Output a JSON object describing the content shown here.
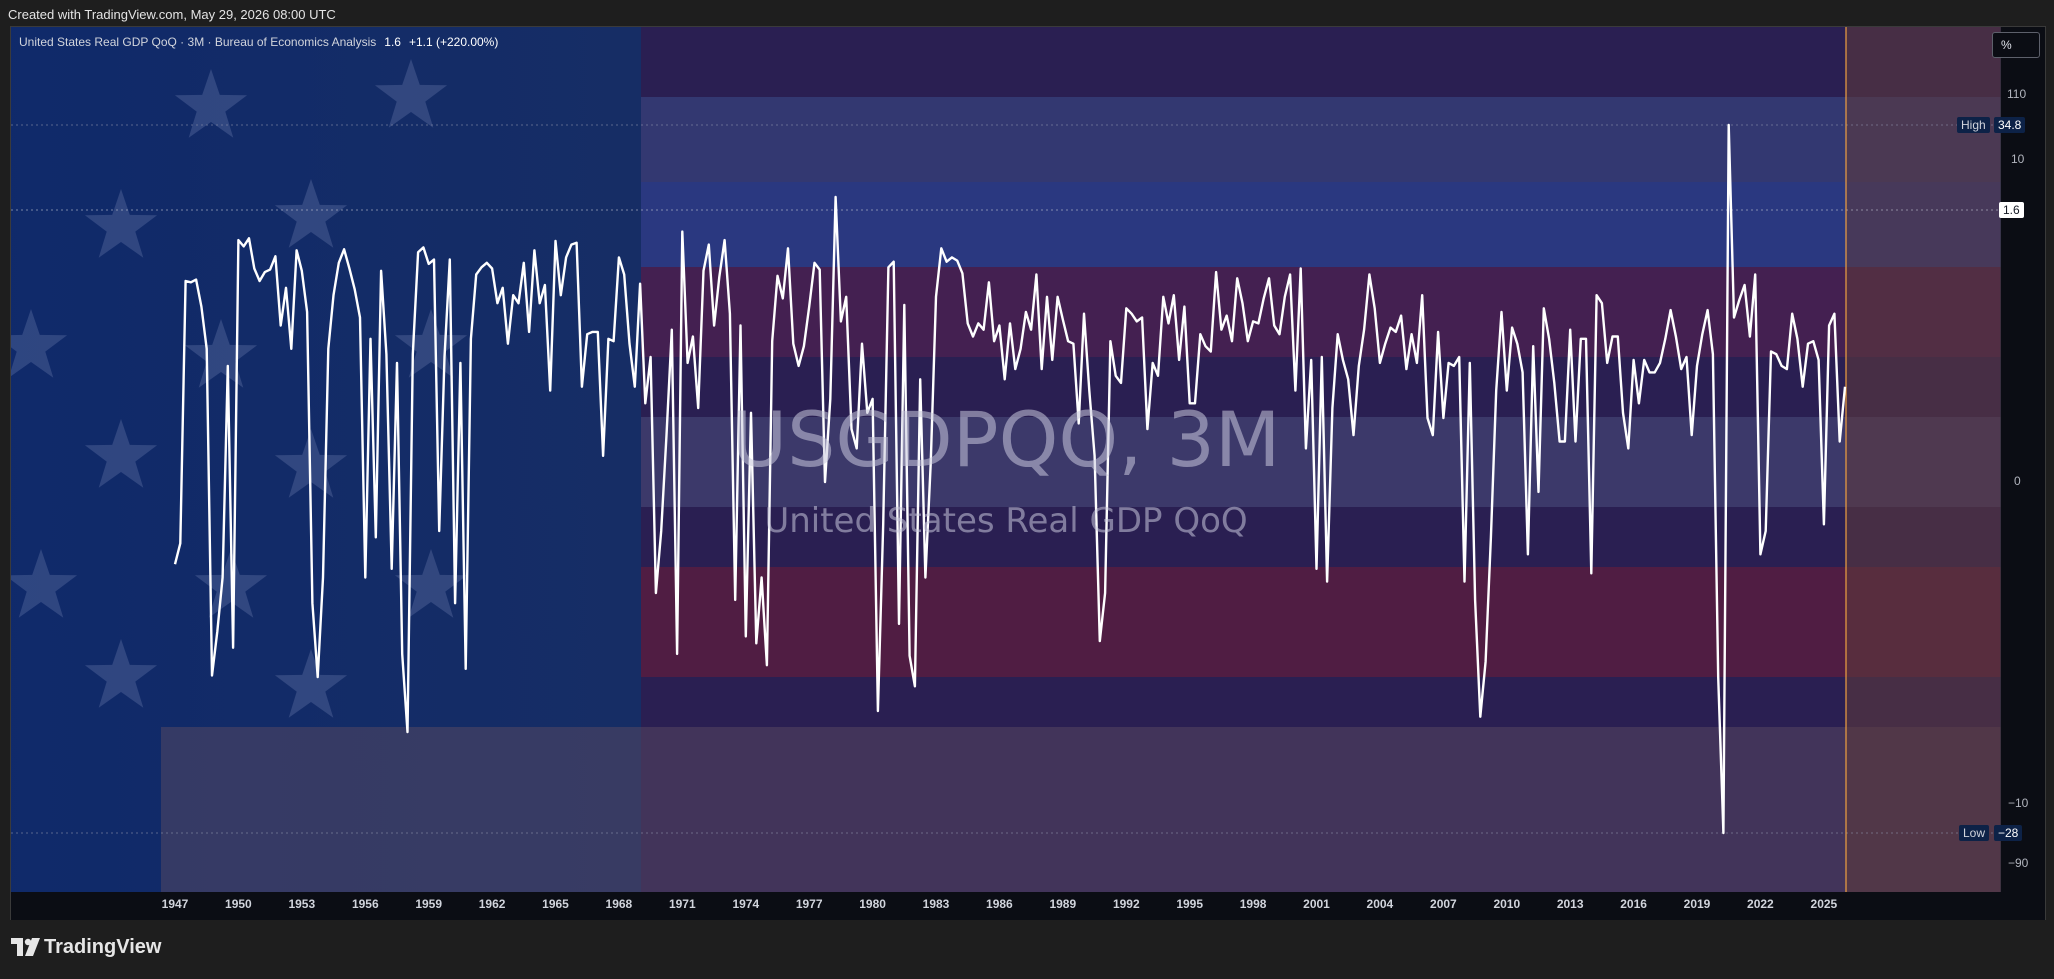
{
  "topbar": {
    "created_text": "Created with TradingView.com, May 29, 2026 08:00 UTC"
  },
  "legend": {
    "title": "United States Real GDP QoQ · 3M · Bureau of Economics Analysis",
    "last_value": "1.6",
    "change": "+1.1 (+220.00%)"
  },
  "scale_button": "%",
  "watermark": {
    "symbol": "USGDPQQ, 3M",
    "description": "United States Real GDP QoQ"
  },
  "price_axis": {
    "ticks": [
      "110",
      "10",
      "0",
      "−10",
      "−90"
    ],
    "high_label": "High",
    "high_value": "34.8",
    "low_label": "Low",
    "low_value": "−28",
    "last_value": "1.6"
  },
  "footer": {
    "brand": "TradingView"
  },
  "colors": {
    "line": "#ffffff",
    "background": "#131722",
    "accent_projection": "#f0a040",
    "tag_blue": "#0d2247"
  },
  "chart_data": {
    "type": "line",
    "title": "United States Real GDP QoQ",
    "series_name": "USGDPQQ",
    "unit": "%",
    "scale": "log-symmetric (percent)",
    "x_ticks": [
      "1947",
      "1950",
      "1953",
      "1956",
      "1959",
      "1962",
      "1965",
      "1968",
      "1971",
      "1974",
      "1977",
      "1980",
      "1983",
      "1986",
      "1989",
      "1992",
      "1995",
      "1998",
      "2001",
      "2004",
      "2007",
      "2010",
      "2013",
      "2016",
      "2019",
      "2022",
      "2025"
    ],
    "x_range": [
      1940.4,
      2033.5
    ],
    "high": 34.8,
    "low": -28,
    "last": 1.6,
    "series": [
      {
        "x": 1947.0,
        "y": -1.2
      },
      {
        "x": 1947.25,
        "y": -0.8
      },
      {
        "x": 1947.5,
        "y": 6.5
      },
      {
        "x": 1947.75,
        "y": 6.4
      },
      {
        "x": 1948.0,
        "y": 6.6
      },
      {
        "x": 1948.25,
        "y": 4.8
      },
      {
        "x": 1948.5,
        "y": 2.8
      },
      {
        "x": 1948.75,
        "y": -5.4
      },
      {
        "x": 1949.0,
        "y": -3.2
      },
      {
        "x": 1949.25,
        "y": -1.5
      },
      {
        "x": 1949.5,
        "y": 2.2
      },
      {
        "x": 1949.75,
        "y": -3.9
      },
      {
        "x": 1950.0,
        "y": 10.3
      },
      {
        "x": 1950.25,
        "y": 9.6
      },
      {
        "x": 1950.5,
        "y": 10.5
      },
      {
        "x": 1950.75,
        "y": 7.5
      },
      {
        "x": 1951.0,
        "y": 6.5
      },
      {
        "x": 1951.25,
        "y": 7.2
      },
      {
        "x": 1951.5,
        "y": 7.4
      },
      {
        "x": 1951.75,
        "y": 8.6
      },
      {
        "x": 1952.0,
        "y": 3.8
      },
      {
        "x": 1952.25,
        "y": 6.0
      },
      {
        "x": 1952.5,
        "y": 2.8
      },
      {
        "x": 1952.75,
        "y": 9.2
      },
      {
        "x": 1953.0,
        "y": 7.3
      },
      {
        "x": 1953.25,
        "y": 4.5
      },
      {
        "x": 1953.5,
        "y": -2.2
      },
      {
        "x": 1953.75,
        "y": -5.5
      },
      {
        "x": 1954.0,
        "y": -1.5
      },
      {
        "x": 1954.25,
        "y": 2.8
      },
      {
        "x": 1954.5,
        "y": 5.5
      },
      {
        "x": 1954.75,
        "y": 8.0
      },
      {
        "x": 1955.0,
        "y": 9.3
      },
      {
        "x": 1955.25,
        "y": 7.5
      },
      {
        "x": 1955.5,
        "y": 5.9
      },
      {
        "x": 1955.75,
        "y": 4.2
      },
      {
        "x": 1956.0,
        "y": -1.5
      },
      {
        "x": 1956.25,
        "y": 3.2
      },
      {
        "x": 1956.5,
        "y": -0.7
      },
      {
        "x": 1956.75,
        "y": 7.3
      },
      {
        "x": 1957.0,
        "y": 2.6
      },
      {
        "x": 1957.25,
        "y": -1.3
      },
      {
        "x": 1957.5,
        "y": 2.3
      },
      {
        "x": 1957.75,
        "y": -4.2
      },
      {
        "x": 1958.0,
        "y": -10.0
      },
      {
        "x": 1958.25,
        "y": 2.6
      },
      {
        "x": 1958.5,
        "y": 9.0
      },
      {
        "x": 1958.75,
        "y": 9.5
      },
      {
        "x": 1959.0,
        "y": 7.9
      },
      {
        "x": 1959.25,
        "y": 8.3
      },
      {
        "x": 1959.5,
        "y": -0.6
      },
      {
        "x": 1959.75,
        "y": 2.5
      },
      {
        "x": 1960.0,
        "y": 8.3
      },
      {
        "x": 1960.25,
        "y": -2.2
      },
      {
        "x": 1960.5,
        "y": 2.3
      },
      {
        "x": 1960.75,
        "y": -5.0
      },
      {
        "x": 1961.0,
        "y": 3.2
      },
      {
        "x": 1961.25,
        "y": 7.0
      },
      {
        "x": 1961.5,
        "y": 7.6
      },
      {
        "x": 1961.75,
        "y": 8.0
      },
      {
        "x": 1962.0,
        "y": 7.5
      },
      {
        "x": 1962.25,
        "y": 5.0
      },
      {
        "x": 1962.5,
        "y": 6.0
      },
      {
        "x": 1962.75,
        "y": 3.0
      },
      {
        "x": 1963.0,
        "y": 5.5
      },
      {
        "x": 1963.25,
        "y": 5.0
      },
      {
        "x": 1963.5,
        "y": 8.0
      },
      {
        "x": 1963.75,
        "y": 3.5
      },
      {
        "x": 1964.0,
        "y": 9.2
      },
      {
        "x": 1964.25,
        "y": 5.0
      },
      {
        "x": 1964.5,
        "y": 6.2
      },
      {
        "x": 1964.75,
        "y": 1.5
      },
      {
        "x": 1965.0,
        "y": 10.2
      },
      {
        "x": 1965.25,
        "y": 5.5
      },
      {
        "x": 1965.5,
        "y": 8.5
      },
      {
        "x": 1965.75,
        "y": 9.8
      },
      {
        "x": 1966.0,
        "y": 10.0
      },
      {
        "x": 1966.25,
        "y": 1.6
      },
      {
        "x": 1966.5,
        "y": 3.4
      },
      {
        "x": 1966.75,
        "y": 3.5
      },
      {
        "x": 1967.0,
        "y": 3.5
      },
      {
        "x": 1967.25,
        "y": 0.3
      },
      {
        "x": 1967.5,
        "y": 3.2
      },
      {
        "x": 1967.75,
        "y": 3.1
      },
      {
        "x": 1968.0,
        "y": 8.5
      },
      {
        "x": 1968.25,
        "y": 7.0
      },
      {
        "x": 1968.5,
        "y": 3.0
      },
      {
        "x": 1968.75,
        "y": 1.6
      },
      {
        "x": 1969.0,
        "y": 6.3
      },
      {
        "x": 1969.25,
        "y": 1.2
      },
      {
        "x": 1969.5,
        "y": 2.5
      },
      {
        "x": 1969.75,
        "y": -1.9
      },
      {
        "x": 1970.0,
        "y": -0.6
      },
      {
        "x": 1970.25,
        "y": 0.6
      },
      {
        "x": 1970.5,
        "y": 3.6
      },
      {
        "x": 1970.75,
        "y": -4.2
      },
      {
        "x": 1971.0,
        "y": 11.3
      },
      {
        "x": 1971.25,
        "y": 2.3
      },
      {
        "x": 1971.5,
        "y": 3.3
      },
      {
        "x": 1971.75,
        "y": 1.1
      },
      {
        "x": 1972.0,
        "y": 7.3
      },
      {
        "x": 1972.25,
        "y": 9.8
      },
      {
        "x": 1972.5,
        "y": 3.8
      },
      {
        "x": 1972.75,
        "y": 6.8
      },
      {
        "x": 1973.0,
        "y": 10.3
      },
      {
        "x": 1973.25,
        "y": 4.4
      },
      {
        "x": 1973.5,
        "y": -2.1
      },
      {
        "x": 1973.75,
        "y": 3.8
      },
      {
        "x": 1974.0,
        "y": -3.4
      },
      {
        "x": 1974.25,
        "y": 1.0
      },
      {
        "x": 1974.5,
        "y": -3.7
      },
      {
        "x": 1974.75,
        "y": -1.5
      },
      {
        "x": 1975.0,
        "y": -4.8
      },
      {
        "x": 1975.25,
        "y": 3.1
      },
      {
        "x": 1975.5,
        "y": 6.9
      },
      {
        "x": 1975.75,
        "y": 5.3
      },
      {
        "x": 1976.0,
        "y": 9.4
      },
      {
        "x": 1976.25,
        "y": 3.0
      },
      {
        "x": 1976.5,
        "y": 2.2
      },
      {
        "x": 1976.75,
        "y": 2.9
      },
      {
        "x": 1977.0,
        "y": 4.8
      },
      {
        "x": 1977.25,
        "y": 8.0
      },
      {
        "x": 1977.5,
        "y": 7.4
      },
      {
        "x": 1977.75,
        "y": 0.0
      },
      {
        "x": 1978.0,
        "y": 1.3
      },
      {
        "x": 1978.25,
        "y": 16.4
      },
      {
        "x": 1978.5,
        "y": 4.0
      },
      {
        "x": 1978.75,
        "y": 5.4
      },
      {
        "x": 1979.0,
        "y": 0.7
      },
      {
        "x": 1979.25,
        "y": 0.4
      },
      {
        "x": 1979.5,
        "y": 3.0
      },
      {
        "x": 1979.75,
        "y": 1.0
      },
      {
        "x": 1980.0,
        "y": 1.3
      },
      {
        "x": 1980.25,
        "y": -8.0
      },
      {
        "x": 1980.5,
        "y": -0.5
      },
      {
        "x": 1980.75,
        "y": 7.6
      },
      {
        "x": 1981.0,
        "y": 8.1
      },
      {
        "x": 1981.25,
        "y": -2.9
      },
      {
        "x": 1981.5,
        "y": 4.9
      },
      {
        "x": 1981.75,
        "y": -4.3
      },
      {
        "x": 1982.0,
        "y": -6.1
      },
      {
        "x": 1982.25,
        "y": 1.8
      },
      {
        "x": 1982.5,
        "y": -1.5
      },
      {
        "x": 1982.75,
        "y": 0.2
      },
      {
        "x": 1983.0,
        "y": 5.4
      },
      {
        "x": 1983.25,
        "y": 9.4
      },
      {
        "x": 1983.5,
        "y": 8.1
      },
      {
        "x": 1983.75,
        "y": 8.5
      },
      {
        "x": 1984.0,
        "y": 8.2
      },
      {
        "x": 1984.25,
        "y": 7.1
      },
      {
        "x": 1984.5,
        "y": 3.9
      },
      {
        "x": 1984.75,
        "y": 3.3
      },
      {
        "x": 1985.0,
        "y": 3.9
      },
      {
        "x": 1985.25,
        "y": 3.6
      },
      {
        "x": 1985.5,
        "y": 6.4
      },
      {
        "x": 1985.75,
        "y": 3.1
      },
      {
        "x": 1986.0,
        "y": 3.8
      },
      {
        "x": 1986.25,
        "y": 1.8
      },
      {
        "x": 1986.5,
        "y": 3.9
      },
      {
        "x": 1986.75,
        "y": 2.1
      },
      {
        "x": 1987.0,
        "y": 2.8
      },
      {
        "x": 1987.25,
        "y": 4.5
      },
      {
        "x": 1987.5,
        "y": 3.6
      },
      {
        "x": 1987.75,
        "y": 7.0
      },
      {
        "x": 1988.0,
        "y": 2.1
      },
      {
        "x": 1988.25,
        "y": 5.4
      },
      {
        "x": 1988.5,
        "y": 2.4
      },
      {
        "x": 1988.75,
        "y": 5.4
      },
      {
        "x": 1989.0,
        "y": 4.1
      },
      {
        "x": 1989.25,
        "y": 3.1
      },
      {
        "x": 1989.5,
        "y": 3.0
      },
      {
        "x": 1989.75,
        "y": 0.8
      },
      {
        "x": 1990.0,
        "y": 4.4
      },
      {
        "x": 1990.25,
        "y": 1.5
      },
      {
        "x": 1990.5,
        "y": 0.3
      },
      {
        "x": 1990.75,
        "y": -3.6
      },
      {
        "x": 1991.0,
        "y": -1.9
      },
      {
        "x": 1991.25,
        "y": 3.1
      },
      {
        "x": 1991.5,
        "y": 1.9
      },
      {
        "x": 1991.75,
        "y": 1.7
      },
      {
        "x": 1992.0,
        "y": 4.7
      },
      {
        "x": 1992.25,
        "y": 4.4
      },
      {
        "x": 1992.5,
        "y": 4.0
      },
      {
        "x": 1992.75,
        "y": 4.2
      },
      {
        "x": 1993.0,
        "y": 0.7
      },
      {
        "x": 1993.25,
        "y": 2.3
      },
      {
        "x": 1993.5,
        "y": 1.9
      },
      {
        "x": 1993.75,
        "y": 5.4
      },
      {
        "x": 1994.0,
        "y": 3.9
      },
      {
        "x": 1994.25,
        "y": 5.5
      },
      {
        "x": 1994.5,
        "y": 2.4
      },
      {
        "x": 1994.75,
        "y": 4.8
      },
      {
        "x": 1995.0,
        "y": 1.2
      },
      {
        "x": 1995.25,
        "y": 1.2
      },
      {
        "x": 1995.5,
        "y": 3.4
      },
      {
        "x": 1995.75,
        "y": 2.9
      },
      {
        "x": 1996.0,
        "y": 2.7
      },
      {
        "x": 1996.25,
        "y": 7.2
      },
      {
        "x": 1996.5,
        "y": 3.6
      },
      {
        "x": 1996.75,
        "y": 4.3
      },
      {
        "x": 1997.0,
        "y": 3.1
      },
      {
        "x": 1997.25,
        "y": 6.7
      },
      {
        "x": 1997.5,
        "y": 5.0
      },
      {
        "x": 1997.75,
        "y": 3.1
      },
      {
        "x": 1998.0,
        "y": 4.0
      },
      {
        "x": 1998.25,
        "y": 3.9
      },
      {
        "x": 1998.5,
        "y": 5.3
      },
      {
        "x": 1998.75,
        "y": 6.7
      },
      {
        "x": 1999.0,
        "y": 3.8
      },
      {
        "x": 1999.25,
        "y": 3.4
      },
      {
        "x": 1999.5,
        "y": 5.4
      },
      {
        "x": 1999.75,
        "y": 7.0
      },
      {
        "x": 2000.0,
        "y": 1.5
      },
      {
        "x": 2000.25,
        "y": 7.5
      },
      {
        "x": 2000.5,
        "y": 0.4
      },
      {
        "x": 2000.75,
        "y": 2.4
      },
      {
        "x": 2001.0,
        "y": -1.3
      },
      {
        "x": 2001.25,
        "y": 2.5
      },
      {
        "x": 2001.5,
        "y": -1.6
      },
      {
        "x": 2001.75,
        "y": 1.1
      },
      {
        "x": 2002.0,
        "y": 3.4
      },
      {
        "x": 2002.25,
        "y": 2.4
      },
      {
        "x": 2002.5,
        "y": 1.8
      },
      {
        "x": 2002.75,
        "y": 0.6
      },
      {
        "x": 2003.0,
        "y": 2.2
      },
      {
        "x": 2003.25,
        "y": 3.6
      },
      {
        "x": 2003.5,
        "y": 7.0
      },
      {
        "x": 2003.75,
        "y": 4.7
      },
      {
        "x": 2004.0,
        "y": 2.3
      },
      {
        "x": 2004.25,
        "y": 3.0
      },
      {
        "x": 2004.5,
        "y": 3.7
      },
      {
        "x": 2004.75,
        "y": 3.5
      },
      {
        "x": 2005.0,
        "y": 4.3
      },
      {
        "x": 2005.25,
        "y": 2.1
      },
      {
        "x": 2005.5,
        "y": 3.4
      },
      {
        "x": 2005.75,
        "y": 2.3
      },
      {
        "x": 2006.0,
        "y": 5.5
      },
      {
        "x": 2006.25,
        "y": 0.9
      },
      {
        "x": 2006.5,
        "y": 0.6
      },
      {
        "x": 2006.75,
        "y": 3.5
      },
      {
        "x": 2007.0,
        "y": 0.9
      },
      {
        "x": 2007.25,
        "y": 2.3
      },
      {
        "x": 2007.5,
        "y": 2.2
      },
      {
        "x": 2007.75,
        "y": 2.5
      },
      {
        "x": 2008.0,
        "y": -1.6
      },
      {
        "x": 2008.25,
        "y": 2.3
      },
      {
        "x": 2008.5,
        "y": -2.1
      },
      {
        "x": 2008.75,
        "y": -8.5
      },
      {
        "x": 2009.0,
        "y": -4.6
      },
      {
        "x": 2009.25,
        "y": -0.7
      },
      {
        "x": 2009.5,
        "y": 1.5
      },
      {
        "x": 2009.75,
        "y": 4.5
      },
      {
        "x": 2010.0,
        "y": 1.5
      },
      {
        "x": 2010.25,
        "y": 3.7
      },
      {
        "x": 2010.5,
        "y": 3.0
      },
      {
        "x": 2010.75,
        "y": 2.0
      },
      {
        "x": 2011.0,
        "y": -1.0
      },
      {
        "x": 2011.25,
        "y": 2.9
      },
      {
        "x": 2011.5,
        "y": -0.1
      },
      {
        "x": 2011.75,
        "y": 4.7
      },
      {
        "x": 2012.0,
        "y": 3.2
      },
      {
        "x": 2012.25,
        "y": 1.7
      },
      {
        "x": 2012.5,
        "y": 0.5
      },
      {
        "x": 2012.75,
        "y": 0.5
      },
      {
        "x": 2013.0,
        "y": 3.6
      },
      {
        "x": 2013.25,
        "y": 0.5
      },
      {
        "x": 2013.5,
        "y": 3.2
      },
      {
        "x": 2013.75,
        "y": 3.2
      },
      {
        "x": 2014.0,
        "y": -1.4
      },
      {
        "x": 2014.25,
        "y": 5.5
      },
      {
        "x": 2014.5,
        "y": 5.0
      },
      {
        "x": 2014.75,
        "y": 2.3
      },
      {
        "x": 2015.0,
        "y": 3.3
      },
      {
        "x": 2015.25,
        "y": 3.3
      },
      {
        "x": 2015.5,
        "y": 1.0
      },
      {
        "x": 2015.75,
        "y": 0.4
      },
      {
        "x": 2016.0,
        "y": 2.4
      },
      {
        "x": 2016.25,
        "y": 1.2
      },
      {
        "x": 2016.5,
        "y": 2.4
      },
      {
        "x": 2016.75,
        "y": 2.0
      },
      {
        "x": 2017.0,
        "y": 2.0
      },
      {
        "x": 2017.25,
        "y": 2.3
      },
      {
        "x": 2017.5,
        "y": 3.2
      },
      {
        "x": 2017.75,
        "y": 4.6
      },
      {
        "x": 2018.0,
        "y": 3.3
      },
      {
        "x": 2018.25,
        "y": 2.1
      },
      {
        "x": 2018.5,
        "y": 2.5
      },
      {
        "x": 2018.75,
        "y": 0.6
      },
      {
        "x": 2019.0,
        "y": 2.2
      },
      {
        "x": 2019.25,
        "y": 3.4
      },
      {
        "x": 2019.5,
        "y": 4.6
      },
      {
        "x": 2019.75,
        "y": 2.6
      },
      {
        "x": 2020.0,
        "y": -5.5
      },
      {
        "x": 2020.25,
        "y": -28.0
      },
      {
        "x": 2020.5,
        "y": 34.8
      },
      {
        "x": 2020.75,
        "y": 4.2
      },
      {
        "x": 2021.0,
        "y": 5.2
      },
      {
        "x": 2021.25,
        "y": 6.2
      },
      {
        "x": 2021.5,
        "y": 3.3
      },
      {
        "x": 2021.75,
        "y": 7.0
      },
      {
        "x": 2022.0,
        "y": -1.0
      },
      {
        "x": 2022.25,
        "y": -0.6
      },
      {
        "x": 2022.5,
        "y": 2.7
      },
      {
        "x": 2022.75,
        "y": 2.6
      },
      {
        "x": 2023.0,
        "y": 2.2
      },
      {
        "x": 2023.25,
        "y": 2.1
      },
      {
        "x": 2023.5,
        "y": 4.4
      },
      {
        "x": 2023.75,
        "y": 3.2
      },
      {
        "x": 2024.0,
        "y": 1.6
      },
      {
        "x": 2024.25,
        "y": 3.0
      },
      {
        "x": 2024.5,
        "y": 3.1
      },
      {
        "x": 2024.75,
        "y": 2.4
      },
      {
        "x": 2025.0,
        "y": -0.5
      },
      {
        "x": 2025.25,
        "y": 3.8
      },
      {
        "x": 2025.5,
        "y": 4.4
      },
      {
        "x": 2025.75,
        "y": 0.5
      },
      {
        "x": 2026.0,
        "y": 1.6
      }
    ]
  }
}
